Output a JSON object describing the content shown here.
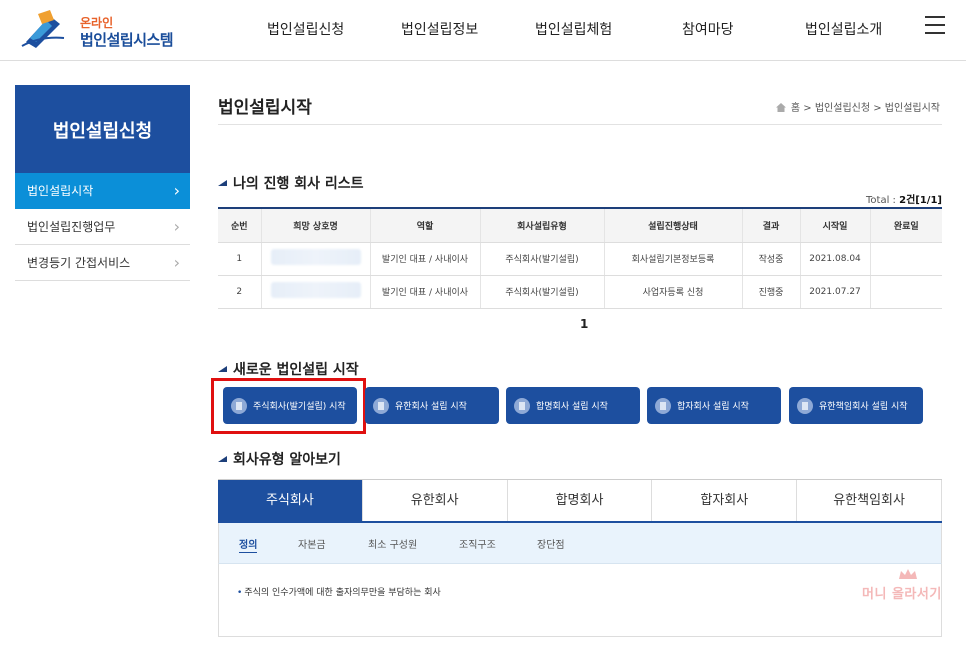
{
  "header": {
    "logo_sub": "온라인",
    "logo_main": "법인설립시스템",
    "nav": [
      "법인설립신청",
      "법인설립정보",
      "법인설립체험",
      "참여마당",
      "법인설립소개"
    ],
    "menu_icon": "hamburger-icon"
  },
  "sidebar": {
    "title": "법인설립신청",
    "items": [
      {
        "label": "법인설립시작",
        "active": true
      },
      {
        "label": "법인설립진행업무",
        "active": false
      },
      {
        "label": "변경등기 간접서비스",
        "active": false
      }
    ]
  },
  "page": {
    "title": "법인설립시작",
    "breadcrumb": [
      "홈",
      "법인설립신청",
      "법인설립시작"
    ]
  },
  "company_list": {
    "title": "나의 진행 회사 리스트",
    "total_label": "Total : ",
    "total_count": "2건",
    "total_pages": "[1/1]",
    "columns": [
      "순번",
      "희망 상호명",
      "역할",
      "회사설립유형",
      "설립진행상태",
      "결과",
      "시작일",
      "완료일"
    ],
    "rows": [
      [
        "1",
        "",
        "발기인 대표 / 사내이사",
        "주식회사(발기설립)",
        "회사설립기본정보등록",
        "작성중",
        "2021.08.04",
        ""
      ],
      [
        "2",
        "",
        "발기인 대표 / 사내이사",
        "주식회사(발기설립)",
        "사업자등록 신청",
        "진행중",
        "2021.07.27",
        ""
      ]
    ],
    "page": "1"
  },
  "new_start": {
    "title": "새로운 법인설립 시작",
    "buttons": [
      "주식회사(발기설립) 시작",
      "유한회사 설립 시작",
      "합명회사 설립 시작",
      "합자회사 설립 시작",
      "유한책임회사 설립 시작"
    ],
    "highlight_color": "#e01010"
  },
  "company_types": {
    "title": "회사유형 알아보기",
    "tabs": [
      "주식회사",
      "유한회사",
      "합명회사",
      "합자회사",
      "유한책임회사"
    ],
    "subtabs": [
      "정의",
      "자본금",
      "최소 구성원",
      "조직구조",
      "장단점"
    ],
    "definition": "주식의 인수가액에 대한 출자의무만을 부담하는 회사"
  },
  "watermark": "머니 올라서기",
  "colors": {
    "primary": "#1d4f9f",
    "active_nav": "#0b8fd8",
    "accent": "#e8622a"
  }
}
